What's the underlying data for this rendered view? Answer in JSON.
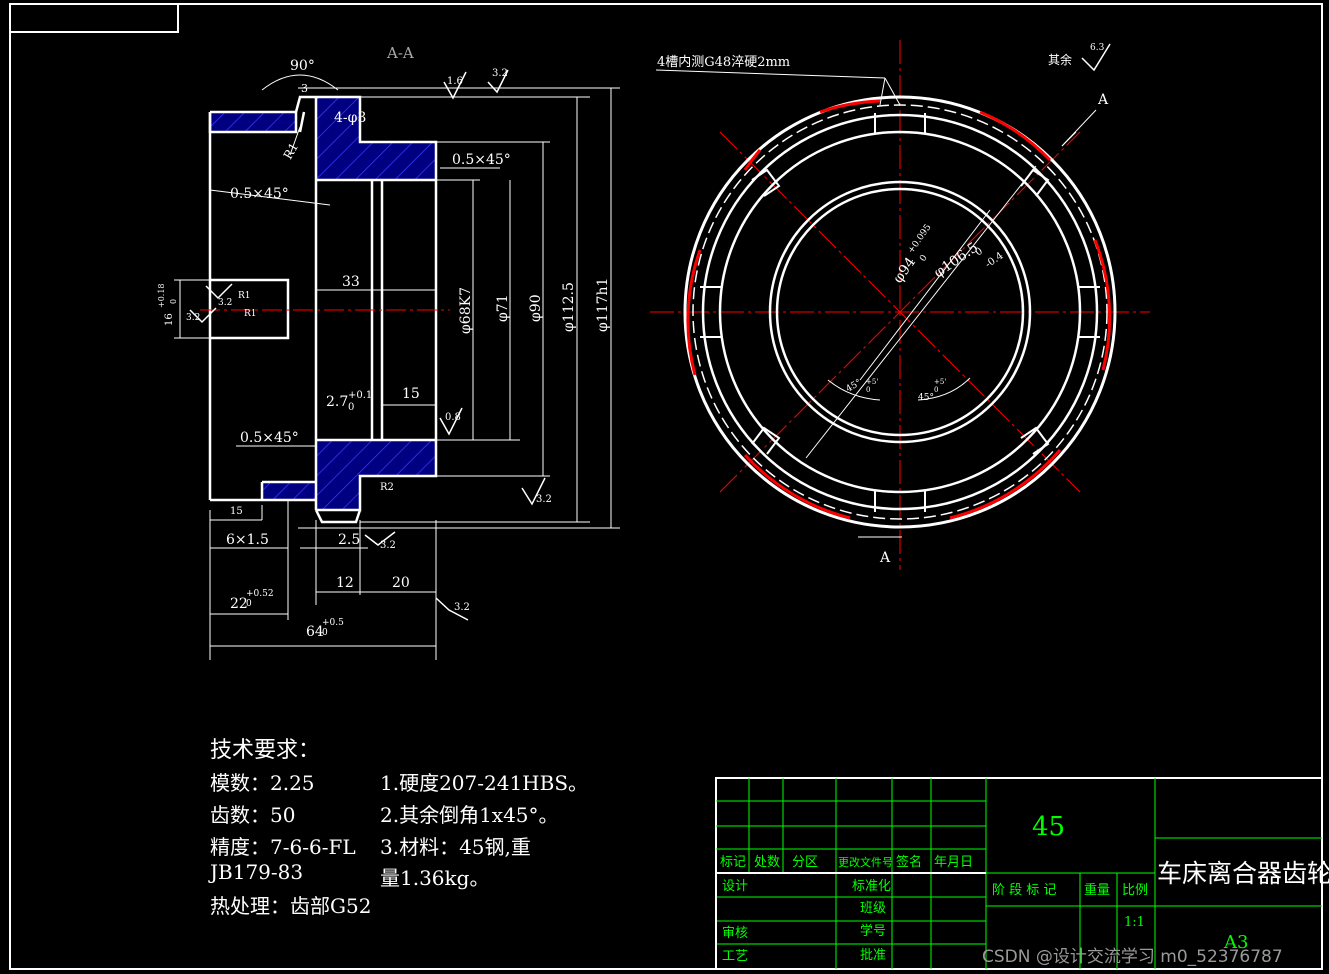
{
  "section_label": "A-A",
  "view_arrow_label": "A",
  "left_view": {
    "angle_90": "90°",
    "dim_3": "3",
    "holes_4phi": "4-φ3",
    "radius_r1": "R1",
    "roughness_1_6": "1.6",
    "roughness_3_2_top": "3.2",
    "chamfer_top_right": "0.5×45°",
    "chamfer_left": "0.5×45°",
    "chamfer_bottom": "0.5×45°",
    "dim_33": "33",
    "dim_27": "2.7",
    "dim_27_tol": "+0.1",
    "dim_27_sub": "0",
    "dim_15_bore": "15",
    "roughness_0_8": "0.8",
    "phi_68k7": "φ68K7",
    "phi_71": "φ71",
    "phi_90": "φ90",
    "phi_112_5": "φ112.5",
    "phi_117h1": "φ117h1",
    "keyway_16": "16",
    "keyway_16_tol": "+0.18",
    "keyway_16_sub": "0",
    "keyway_r1a": "R1",
    "keyway_r1b": "R1",
    "keyway_ra_a": "3.2",
    "keyway_ra_b": "3.2",
    "r2": "R2",
    "roughness_3_2_right": "3.2",
    "dim_15_bottom": "15",
    "dim_6x1_5": "6×1.5",
    "dim_2_5": "2.5",
    "roughness_3_2_mid": "3.2",
    "dim_12": "12",
    "dim_20": "20",
    "dim_22": "22",
    "dim_22_tol": "+0.52",
    "dim_22_sub": "0",
    "dim_64": "64",
    "dim_64_tol": "+0.5",
    "dim_64_sub": "0",
    "roughness_3_2_bottom": "3.2"
  },
  "right_view": {
    "slot_note": "4槽内测G48淬硬2mm",
    "remaining_label": "其余",
    "remaining_roughness": "6.3",
    "phi_94": "φ94",
    "phi_94_tol": "+0.095",
    "phi_94_sub": "0",
    "phi_106_5": "φ106.5",
    "phi_106_5_tol": "0",
    "phi_106_5_sub": "-0.4",
    "angle_a": "45°",
    "angle_a_tol": "+5'",
    "angle_a_sub": "0",
    "angle_b": "45°",
    "angle_b_tol": "+5'",
    "angle_b_sub": "0"
  },
  "requirements": {
    "title": "技术要求：",
    "module": "模数：2.25",
    "teeth": "齿数：50",
    "accuracy": "精度：7-6-6-FL",
    "standard": "JB179-83",
    "heat": "热处理：齿部G52",
    "item1": "1.硬度207-241HBS。",
    "item2": "2.其余倒角1x45°。",
    "item3a": "3.材料：45钢,重",
    "item3b": "量1.36kg。"
  },
  "title_block": {
    "material": "45",
    "part_name": "车床离合器齿轮",
    "h_mark": "标记",
    "h_qty": "处数",
    "h_zone": "分区",
    "h_doc": "更改文件号",
    "h_sign": "签名",
    "h_date": "年月日",
    "design": "设计",
    "standardize": "标准化",
    "check": "审核",
    "process": "工艺",
    "class": "班级",
    "student_no": "学号",
    "approve": "批准",
    "stage": "阶 段 标 记",
    "weight": "重量",
    "scale_label": "比例",
    "scale": "1:1",
    "sheet_size": "A3"
  },
  "watermark": "CSDN @设计交流学习 m0_52376787",
  "colors": {
    "outline": "#ffffff",
    "center": "#ff0000",
    "hatch": "#0000ff",
    "grid": "#00ff00",
    "text_green": "#00ff00"
  }
}
